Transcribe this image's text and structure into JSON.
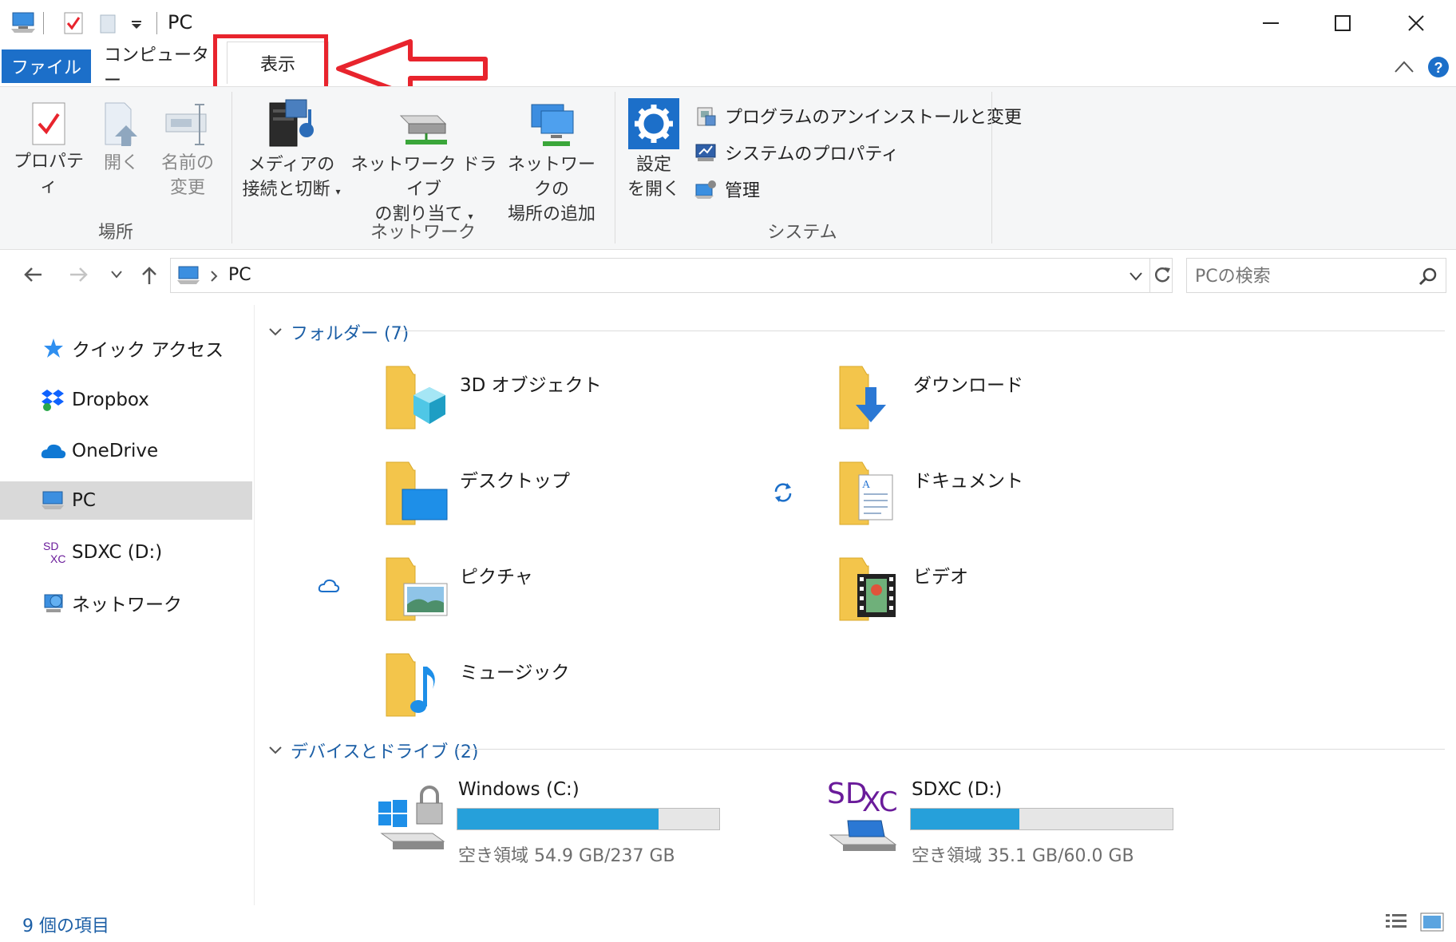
{
  "window": {
    "title": "PC"
  },
  "tabs": {
    "file": "ファイル",
    "computer": "コンピューター",
    "view": "表示"
  },
  "ribbon": {
    "place": {
      "properties": "プロパティ",
      "open": "開く",
      "rename_1": "名前の",
      "rename_2": "変更",
      "group": "場所"
    },
    "network": {
      "media_1": "メディアの",
      "media_2": "接続と切断",
      "map_1": "ネットワーク ドライブ",
      "map_2": "の割り当て",
      "add_1": "ネットワークの",
      "add_2": "場所の追加",
      "group": "ネットワーク"
    },
    "system": {
      "settings_1": "設定",
      "settings_2": "を開く",
      "uninstall": "プログラムのアンインストールと変更",
      "sysprops": "システムのプロパティ",
      "manage": "管理",
      "group": "システム"
    }
  },
  "address": {
    "path": "PC",
    "search_placeholder": "PCの検索"
  },
  "sidebar": {
    "items": [
      "クイック アクセス",
      "Dropbox",
      "OneDrive",
      "PC",
      "SDXC (D:)",
      "ネットワーク"
    ]
  },
  "folders": {
    "header": "フォルダー (7)",
    "items": [
      "3D オブジェクト",
      "ダウンロード",
      "デスクトップ",
      "ドキュメント",
      "ピクチャ",
      "ビデオ",
      "ミュージック"
    ]
  },
  "drives": {
    "header": "デバイスとドライブ (2)",
    "items": [
      {
        "name": "Windows (C:)",
        "free": "空き領域 54.9 GB/237 GB",
        "used_fraction": 0.768
      },
      {
        "name": "SDXC (D:)",
        "free": "空き領域 35.1 GB/60.0 GB",
        "used_fraction": 0.415,
        "logo": "SDXC"
      }
    ]
  },
  "status": {
    "count": "9 個の項目"
  },
  "colors": {
    "accent": "#1c6fc9",
    "highlight": "#e8242d",
    "bar": "#26a0da"
  }
}
